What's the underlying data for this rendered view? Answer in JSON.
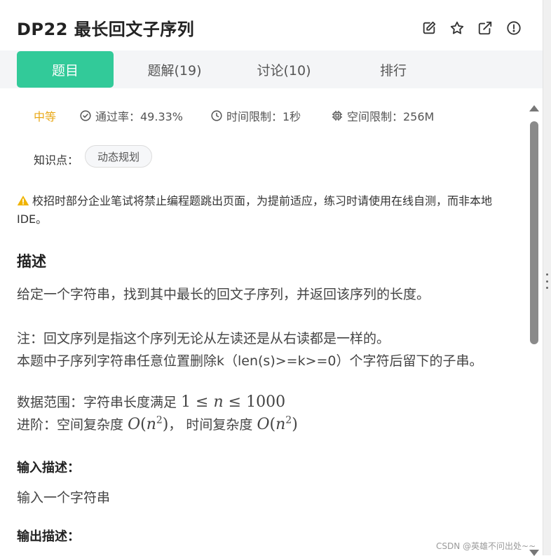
{
  "header": {
    "title": "DP22  最长回文子序列",
    "icons": [
      "edit-icon",
      "star-icon",
      "external-link-icon",
      "report-icon"
    ]
  },
  "tabs": [
    {
      "label": "题目",
      "active": true
    },
    {
      "label": "题解(19)",
      "active": false
    },
    {
      "label": "讨论(10)",
      "active": false
    },
    {
      "label": "排行",
      "active": false
    }
  ],
  "meta": {
    "difficulty": "中等",
    "pass_rate": "通过率：49.33%",
    "time_limit": "时间限制：1秒",
    "space_limit": "空间限制：256M"
  },
  "knowledge": {
    "label": "知识点：",
    "tag": "动态规划"
  },
  "warning": "校招时部分企业笔试将禁止编程题跳出页面，为提前适应，练习时请使用在线自测，而非本地IDE。",
  "description": {
    "heading": "描述",
    "line1": "给定一个字符串，找到其中最长的回文子序列，并返回该序列的长度。",
    "note1": "注：回文序列是指这个序列无论从左读还是从右读都是一样的。",
    "note2": "本题中子序列字符串任意位置删除k（len(s)>=k>=0）个字符后留下的子串。",
    "range_prefix": "数据范围：字符串长度满足",
    "advanced_prefix": "进阶：空间复杂度",
    "advanced_sep": "，  时间复杂度"
  },
  "input": {
    "heading": "输入描述：",
    "text": "输入一个字符串"
  },
  "output": {
    "heading": "输出描述："
  },
  "watermark": "CSDN @英雄不问出处~~",
  "colors": {
    "accent": "#32ca99",
    "difficulty": "#e9a817",
    "warning": "#f0b400"
  }
}
